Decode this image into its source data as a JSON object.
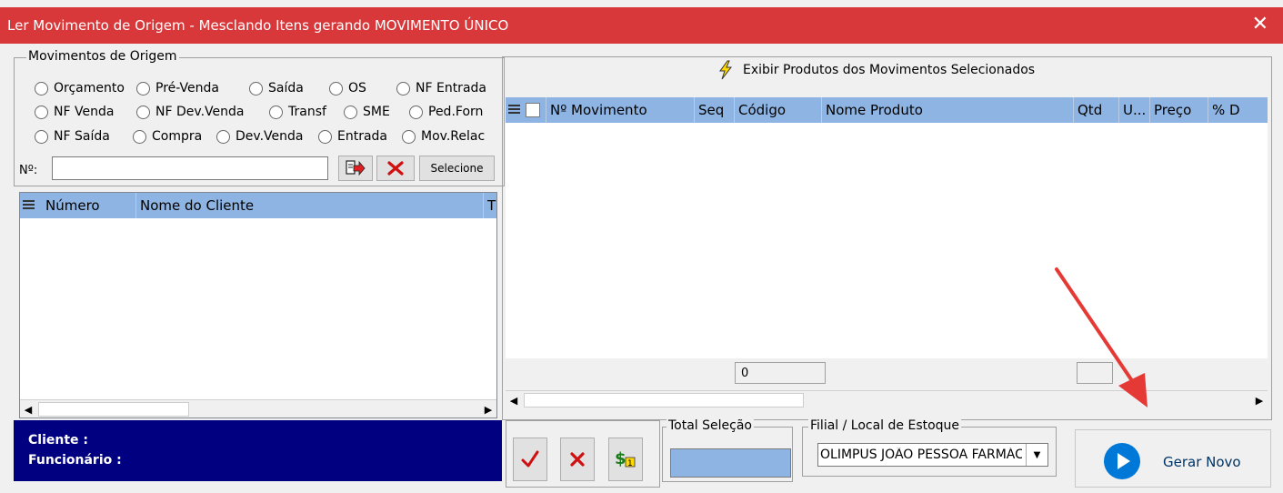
{
  "window": {
    "title": "Ler Movimento de Origem - Mesclando Itens gerando MOVIMENTO ÚNICO",
    "close_glyph": "✕"
  },
  "origem": {
    "legend": "Movimentos de Origem",
    "radios_row1": [
      "Orçamento",
      "Pré-Venda",
      "Saída",
      "OS",
      "NF Entrada"
    ],
    "radios_row2": [
      "NF Venda",
      "NF Dev.Venda",
      "Transf",
      "SME",
      "Ped.Forn"
    ],
    "radios_row3": [
      "NF Saída",
      "Compra",
      "Dev.Venda",
      "Entrada",
      "Mov.Relac"
    ],
    "numero_label": "Nº:",
    "numero_value": "",
    "selecione_label": "Selecione"
  },
  "left_grid": {
    "columns": [
      "Número",
      "Nome do Cliente",
      "T"
    ]
  },
  "info": {
    "cliente_label": "Cliente :",
    "funcionario_label": "Funcionário :"
  },
  "produtos": {
    "exibir_label": "Exibir Produtos dos Movimentos Selecionados",
    "columns": [
      "Nº Movimento",
      "Seq",
      "Código",
      "Nome Produto",
      "Qtd",
      "U...",
      "Preço",
      "% D"
    ],
    "footer_total": "0"
  },
  "total_selecao": {
    "legend": "Total Seleção",
    "value": ""
  },
  "filial": {
    "legend": "Filial / Local de Estoque",
    "selected": "OLIMPUS JOÃO PESSOA FARMÁCIA"
  },
  "gerar_novo_label": "Gerar Novo",
  "colors": {
    "titlebar": "#d9383a",
    "grid_header": "#8db4e2",
    "info_panel": "#000080",
    "accent_blue": "#0078d7",
    "arrow_red": "#e53935"
  }
}
